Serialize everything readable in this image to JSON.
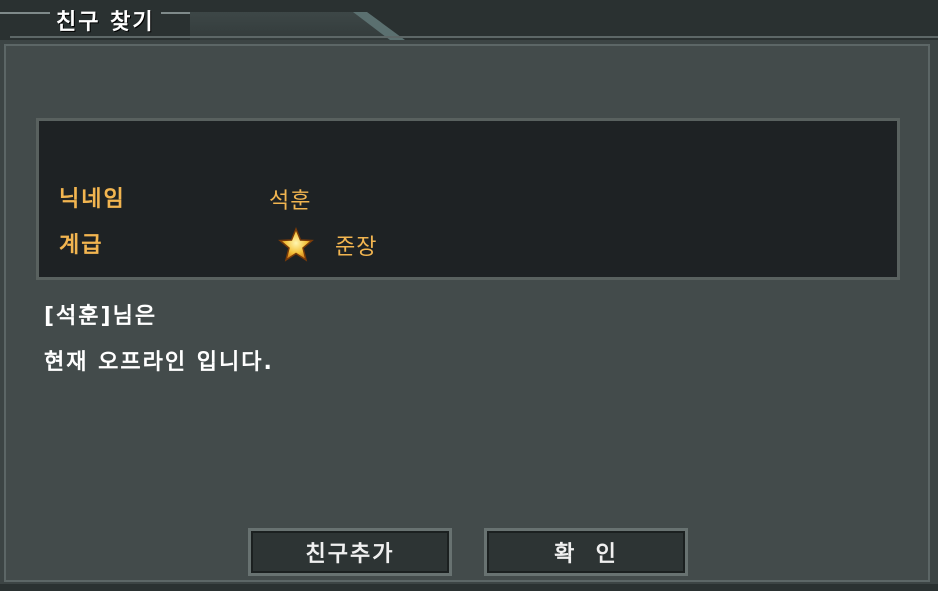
{
  "window": {
    "title": "친구 찾기"
  },
  "info": {
    "nickname_label": "닉네임",
    "nickname_value": "석훈",
    "rank_label": "계급",
    "rank_value": "준장",
    "rank_icon": "star-icon"
  },
  "message": {
    "line1": "[석훈]님은",
    "line2": "현재 오프라인 입니다."
  },
  "buttons": {
    "add_friend": "친구추가",
    "confirm": "확  인"
  },
  "colors": {
    "label": "#f2b550",
    "background": "#434b4b",
    "panel": "#1e2224"
  }
}
